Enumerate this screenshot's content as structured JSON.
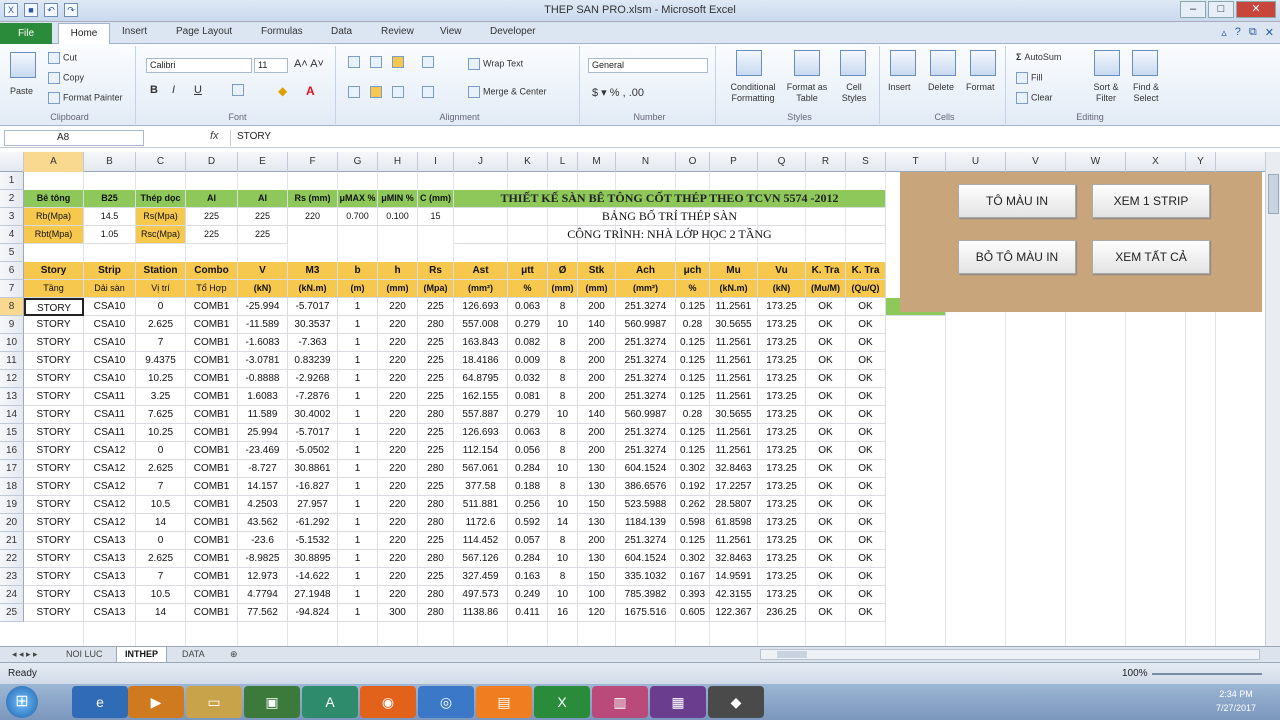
{
  "window": {
    "title": "THEP SAN PRO.xlsm - Microsoft Excel"
  },
  "ribbon": {
    "tabs": [
      "File",
      "Home",
      "Insert",
      "Page Layout",
      "Formulas",
      "Data",
      "Review",
      "View",
      "Developer"
    ],
    "clipboard": {
      "paste": "Paste",
      "cut": "Cut",
      "copy": "Copy",
      "format_painter": "Format Painter",
      "label": "Clipboard"
    },
    "font": {
      "name": "Calibri",
      "size": "11",
      "label": "Font"
    },
    "alignment": {
      "wrap": "Wrap Text",
      "merge": "Merge & Center",
      "label": "Alignment"
    },
    "number": {
      "format": "General",
      "label": "Number"
    },
    "styles": {
      "cond": "Conditional Formatting",
      "table": "Format as Table",
      "cell": "Cell Styles",
      "label": "Styles"
    },
    "cells": {
      "insert": "Insert",
      "delete": "Delete",
      "format": "Format",
      "label": "Cells"
    },
    "editing": {
      "autosum": "AutoSum",
      "fill": "Fill",
      "clear": "Clear",
      "sort": "Sort & Filter",
      "find": "Find & Select",
      "label": "Editing"
    }
  },
  "formula_bar": {
    "name_box": "A8",
    "fx": "fx",
    "value": "STORY"
  },
  "columns": [
    "A",
    "B",
    "C",
    "D",
    "E",
    "F",
    "G",
    "H",
    "I",
    "J",
    "K",
    "L",
    "M",
    "N",
    "O",
    "P",
    "Q",
    "R",
    "S",
    "T",
    "U",
    "V",
    "W",
    "X",
    "Y"
  ],
  "rows": [
    "1",
    "2",
    "3",
    "4",
    "5",
    "6",
    "7",
    "8",
    "9",
    "10",
    "11",
    "12",
    "13",
    "14",
    "15",
    "16",
    "17",
    "18",
    "19",
    "20",
    "21",
    "22",
    "23",
    "24",
    "25"
  ],
  "params": {
    "r2": [
      "Bê tông",
      "B25",
      "Thép dọc",
      "AI",
      "AI",
      "Rs (mm)",
      "μMAX %",
      "μMIN %",
      "C (mm)"
    ],
    "r3": [
      "Rb(Mpa)",
      "14.5",
      "Rs(Mpa)",
      "225",
      "225",
      "220",
      "0.700",
      "0.100",
      "15"
    ],
    "r4": [
      "Rbt(Mpa)",
      "1.05",
      "Rsc(Mpa)",
      "225",
      "225"
    ]
  },
  "title_block": {
    "t1": "THIẾT KẾ SÀN BÊ TÔNG CỐT THÉP THEO TCVN 5574 -2012",
    "t2": "BẢNG BỐ TRÍ THÉP SÀN",
    "t3": "CÔNG TRÌNH: NHÀ LỚP HỌC 2 TẦNG"
  },
  "table_header": {
    "r6": [
      "Story",
      "Strip",
      "Station",
      "Combo",
      "V",
      "M3",
      "b",
      "h",
      "Rs",
      "Ast",
      "μtt",
      "Ø",
      "Stk",
      "Ach",
      "μch",
      "Mu",
      "Vu",
      "K. Tra",
      "K. Tra"
    ],
    "r7": [
      "Tầng",
      "Dải sàn",
      "Vị trí",
      "Tổ Hợp",
      "(kN)",
      "(kN.m)",
      "(m)",
      "(mm)",
      "(Mpa)",
      "(mm²)",
      "%",
      "(mm)",
      "(mm)",
      "(mm²)",
      "%",
      "(kN.m)",
      "(kN)",
      "(Mu/M)",
      "(Qu/Q)"
    ]
  },
  "table_rows": [
    [
      "STORY",
      "CSA10",
      "0",
      "COMB1",
      "-25.994",
      "-5.7017",
      "1",
      "220",
      "225",
      "126.693",
      "0.063",
      "8",
      "200",
      "251.3274",
      "0.125",
      "11.2561",
      "173.25",
      "OK",
      "OK"
    ],
    [
      "STORY",
      "CSA10",
      "2.625",
      "COMB1",
      "-11.589",
      "30.3537",
      "1",
      "220",
      "280",
      "557.008",
      "0.279",
      "10",
      "140",
      "560.9987",
      "0.28",
      "30.5655",
      "173.25",
      "OK",
      "OK"
    ],
    [
      "STORY",
      "CSA10",
      "7",
      "COMB1",
      "-1.6083",
      "-7.363",
      "1",
      "220",
      "225",
      "163.843",
      "0.082",
      "8",
      "200",
      "251.3274",
      "0.125",
      "11.2561",
      "173.25",
      "OK",
      "OK"
    ],
    [
      "STORY",
      "CSA10",
      "9.4375",
      "COMB1",
      "-3.0781",
      "0.83239",
      "1",
      "220",
      "225",
      "18.4186",
      "0.009",
      "8",
      "200",
      "251.3274",
      "0.125",
      "11.2561",
      "173.25",
      "OK",
      "OK"
    ],
    [
      "STORY",
      "CSA10",
      "10.25",
      "COMB1",
      "-0.8888",
      "-2.9268",
      "1",
      "220",
      "225",
      "64.8795",
      "0.032",
      "8",
      "200",
      "251.3274",
      "0.125",
      "11.2561",
      "173.25",
      "OK",
      "OK"
    ],
    [
      "STORY",
      "CSA11",
      "3.25",
      "COMB1",
      "1.6083",
      "-7.2876",
      "1",
      "220",
      "225",
      "162.155",
      "0.081",
      "8",
      "200",
      "251.3274",
      "0.125",
      "11.2561",
      "173.25",
      "OK",
      "OK"
    ],
    [
      "STORY",
      "CSA11",
      "7.625",
      "COMB1",
      "11.589",
      "30.4002",
      "1",
      "220",
      "280",
      "557.887",
      "0.279",
      "10",
      "140",
      "560.9987",
      "0.28",
      "30.5655",
      "173.25",
      "OK",
      "OK"
    ],
    [
      "STORY",
      "CSA11",
      "10.25",
      "COMB1",
      "25.994",
      "-5.7017",
      "1",
      "220",
      "225",
      "126.693",
      "0.063",
      "8",
      "200",
      "251.3274",
      "0.125",
      "11.2561",
      "173.25",
      "OK",
      "OK"
    ],
    [
      "STORY",
      "CSA12",
      "0",
      "COMB1",
      "-23.469",
      "-5.0502",
      "1",
      "220",
      "225",
      "112.154",
      "0.056",
      "8",
      "200",
      "251.3274",
      "0.125",
      "11.2561",
      "173.25",
      "OK",
      "OK"
    ],
    [
      "STORY",
      "CSA12",
      "2.625",
      "COMB1",
      "-8.727",
      "30.8861",
      "1",
      "220",
      "280",
      "567.061",
      "0.284",
      "10",
      "130",
      "604.1524",
      "0.302",
      "32.8463",
      "173.25",
      "OK",
      "OK"
    ],
    [
      "STORY",
      "CSA12",
      "7",
      "COMB1",
      "14.157",
      "-16.827",
      "1",
      "220",
      "225",
      "377.58",
      "0.188",
      "8",
      "130",
      "386.6576",
      "0.192",
      "17.2257",
      "173.25",
      "OK",
      "OK"
    ],
    [
      "STORY",
      "CSA12",
      "10.5",
      "COMB1",
      "4.2503",
      "27.957",
      "1",
      "220",
      "280",
      "511.881",
      "0.256",
      "10",
      "150",
      "523.5988",
      "0.262",
      "28.5807",
      "173.25",
      "OK",
      "OK"
    ],
    [
      "STORY",
      "CSA12",
      "14",
      "COMB1",
      "43.562",
      "-61.292",
      "1",
      "220",
      "280",
      "1172.6",
      "0.592",
      "14",
      "130",
      "1184.139",
      "0.598",
      "61.8598",
      "173.25",
      "OK",
      "OK"
    ],
    [
      "STORY",
      "CSA13",
      "0",
      "COMB1",
      "-23.6",
      "-5.1532",
      "1",
      "220",
      "225",
      "114.452",
      "0.057",
      "8",
      "200",
      "251.3274",
      "0.125",
      "11.2561",
      "173.25",
      "OK",
      "OK"
    ],
    [
      "STORY",
      "CSA13",
      "2.625",
      "COMB1",
      "-8.9825",
      "30.8895",
      "1",
      "220",
      "280",
      "567.126",
      "0.284",
      "10",
      "130",
      "604.1524",
      "0.302",
      "32.8463",
      "173.25",
      "OK",
      "OK"
    ],
    [
      "STORY",
      "CSA13",
      "7",
      "COMB1",
      "12.973",
      "-14.622",
      "1",
      "220",
      "225",
      "327.459",
      "0.163",
      "8",
      "150",
      "335.1032",
      "0.167",
      "14.9591",
      "173.25",
      "OK",
      "OK"
    ],
    [
      "STORY",
      "CSA13",
      "10.5",
      "COMB1",
      "4.7794",
      "27.1948",
      "1",
      "220",
      "280",
      "497.573",
      "0.249",
      "10",
      "100",
      "785.3982",
      "0.393",
      "42.3155",
      "173.25",
      "OK",
      "OK"
    ],
    [
      "STORY",
      "CSA13",
      "14",
      "COMB1",
      "77.562",
      "-94.824",
      "1",
      "300",
      "280",
      "1138.86",
      "0.411",
      "16",
      "120",
      "1675.516",
      "0.605",
      "122.367",
      "236.25",
      "OK",
      "OK"
    ]
  ],
  "buttons": {
    "to_mau_in": "TÔ MÀU IN",
    "xem_1_strip": "XEM 1 STRIP",
    "bo_to_mau_in": "BỎ TÔ MÀU IN",
    "xem_tat_ca": "XEM TẤT CẢ"
  },
  "sheets": [
    "NOI LUC",
    "INTHEP",
    "DATA"
  ],
  "active_sheet": "INTHEP",
  "status": {
    "ready": "Ready",
    "zoom": "100%"
  },
  "clock": {
    "time": "2:34 PM",
    "date": "7/27/2017"
  },
  "colors": {
    "yellow": "#f6c84d",
    "green": "#8fc85a",
    "panel": "#c8a57a",
    "file_tab": "#2a8c3a"
  }
}
